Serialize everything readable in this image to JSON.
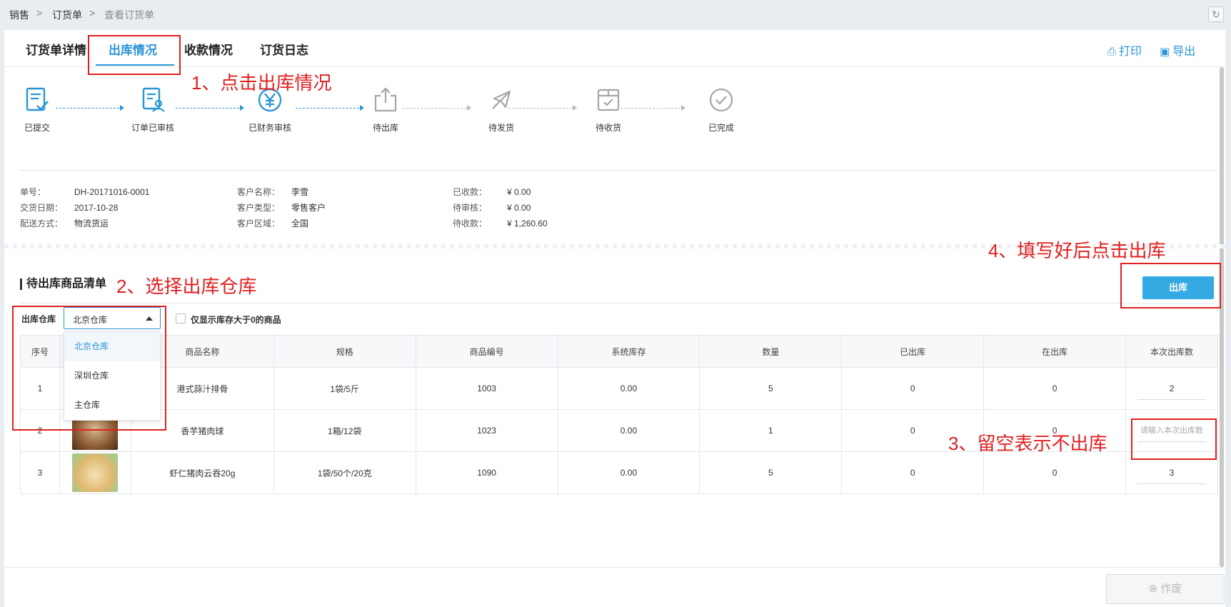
{
  "breadcrumb": {
    "items": [
      "销售",
      "订货单",
      "查看订货单"
    ],
    "separator": ">"
  },
  "tabs": [
    {
      "label": "订货单详情",
      "active": false
    },
    {
      "label": "出库情况",
      "active": true
    },
    {
      "label": "收款情况",
      "active": false
    },
    {
      "label": "订货日志",
      "active": false
    }
  ],
  "header_actions": {
    "print_label": "打印",
    "export_label": "导出"
  },
  "steps": [
    {
      "label": "已提交",
      "icon": "doc-check-icon",
      "done": true
    },
    {
      "label": "订单已审核",
      "icon": "doc-user-icon",
      "done": true
    },
    {
      "label": "已财务审核",
      "icon": "yen-circle-icon",
      "done": true
    },
    {
      "label": "待出库",
      "icon": "share-out-icon",
      "done": false
    },
    {
      "label": "待发货",
      "icon": "plane-icon",
      "done": false
    },
    {
      "label": "待收货",
      "icon": "box-check-icon",
      "done": false
    },
    {
      "label": "已完成",
      "icon": "check-circle-icon",
      "done": false
    }
  ],
  "order_info": {
    "number": {
      "label": "单号：",
      "value": "DH-20171016-0001"
    },
    "delivery_date": {
      "label": "交货日期：",
      "value": "2017-10-28"
    },
    "shipping_method": {
      "label": "配送方式：",
      "value": "物流货运"
    },
    "customer_name": {
      "label": "客户名称：",
      "value": "李雪"
    },
    "customer_type": {
      "label": "客户类型：",
      "value": "零售客户"
    },
    "customer_region": {
      "label": "客户区域：",
      "value": "全国"
    },
    "received": {
      "label": "已收款：",
      "value": "¥ 0.00"
    },
    "pending_review": {
      "label": "待审核：",
      "value": "¥ 0.00"
    },
    "pending_receipt": {
      "label": "待收款：",
      "value": "¥ 1,260.60"
    }
  },
  "section": {
    "title": "待出库商品清单",
    "ship_button": "出库"
  },
  "warehouse": {
    "label": "出库仓库",
    "selected": "北京仓库",
    "options": [
      "北京仓库",
      "深圳仓库",
      "主仓库"
    ]
  },
  "filter": {
    "label": "仅显示库存大于0的商品",
    "checked": false
  },
  "table": {
    "columns": [
      "序号",
      "",
      "商品名称",
      "规格",
      "商品编号",
      "系统库存",
      "数量",
      "已出库",
      "在出库",
      "本次出库数"
    ],
    "rows": [
      {
        "no": "1",
        "name": "港式蒜汁排骨",
        "spec": "1袋/5斤",
        "code": "1003",
        "stock": "0.00",
        "qty": "5",
        "shipped": "0",
        "shipping": "0",
        "this_qty": "2",
        "placeholder": ""
      },
      {
        "no": "2",
        "name": "香芋猪肉球",
        "spec": "1箱/12袋",
        "code": "1023",
        "stock": "0.00",
        "qty": "1",
        "shipped": "0",
        "shipping": "0",
        "this_qty": "",
        "placeholder": "请输入本次出库数"
      },
      {
        "no": "3",
        "name": "虾仁猪肉云吞20g",
        "spec": "1袋/50个/20克",
        "code": "1090",
        "stock": "0.00",
        "qty": "5",
        "shipped": "0",
        "shipping": "0",
        "this_qty": "3",
        "placeholder": ""
      }
    ]
  },
  "footer": {
    "void_label": "作废"
  },
  "annotations": [
    "1、点击出库情况",
    "2、选择出库仓库",
    "3、留空表示不出库",
    "4、填写好后点击出库"
  ],
  "colors": {
    "accent": "#2a95d6",
    "button": "#35a9e2",
    "annotation": "#e02020",
    "inactive_step": "#b8b8b8"
  }
}
